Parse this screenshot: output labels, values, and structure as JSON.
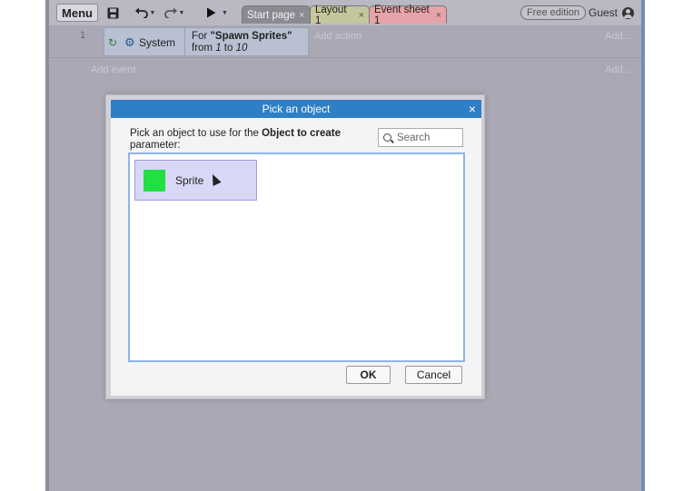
{
  "toolbar": {
    "menu_label": "Menu",
    "tabs": [
      {
        "label": "Start page",
        "close": "×"
      },
      {
        "label": "Layout 1",
        "close": "×"
      },
      {
        "label": "Event sheet 1",
        "close": "×"
      }
    ],
    "edition": "Free edition",
    "user": "Guest"
  },
  "event_sheet": {
    "event_number": "1",
    "condition_object": "System",
    "condition_prefix": "For ",
    "condition_name": "\"Spawn Sprites\"",
    "condition_from_prefix": "from ",
    "condition_from": "1",
    "condition_to_word": " to ",
    "condition_to": "10",
    "add_action": "Add action",
    "add_right_1": "Add...",
    "add_event": "Add event",
    "add_right_2": "Add..."
  },
  "dialog": {
    "title": "Pick an object",
    "close": "×",
    "prompt_prefix": "Pick an object to use for the ",
    "prompt_bold": "Object to create",
    "prompt_suffix": " parameter:",
    "search_placeholder": "Search",
    "objects": [
      {
        "name": "Sprite",
        "color": "#22e043"
      }
    ],
    "ok_label": "OK",
    "cancel_label": "Cancel"
  },
  "colors": {
    "title_bar": "#2f7fc6",
    "selected_item": "#d8d8f6",
    "list_border": "#8fb3e8"
  }
}
